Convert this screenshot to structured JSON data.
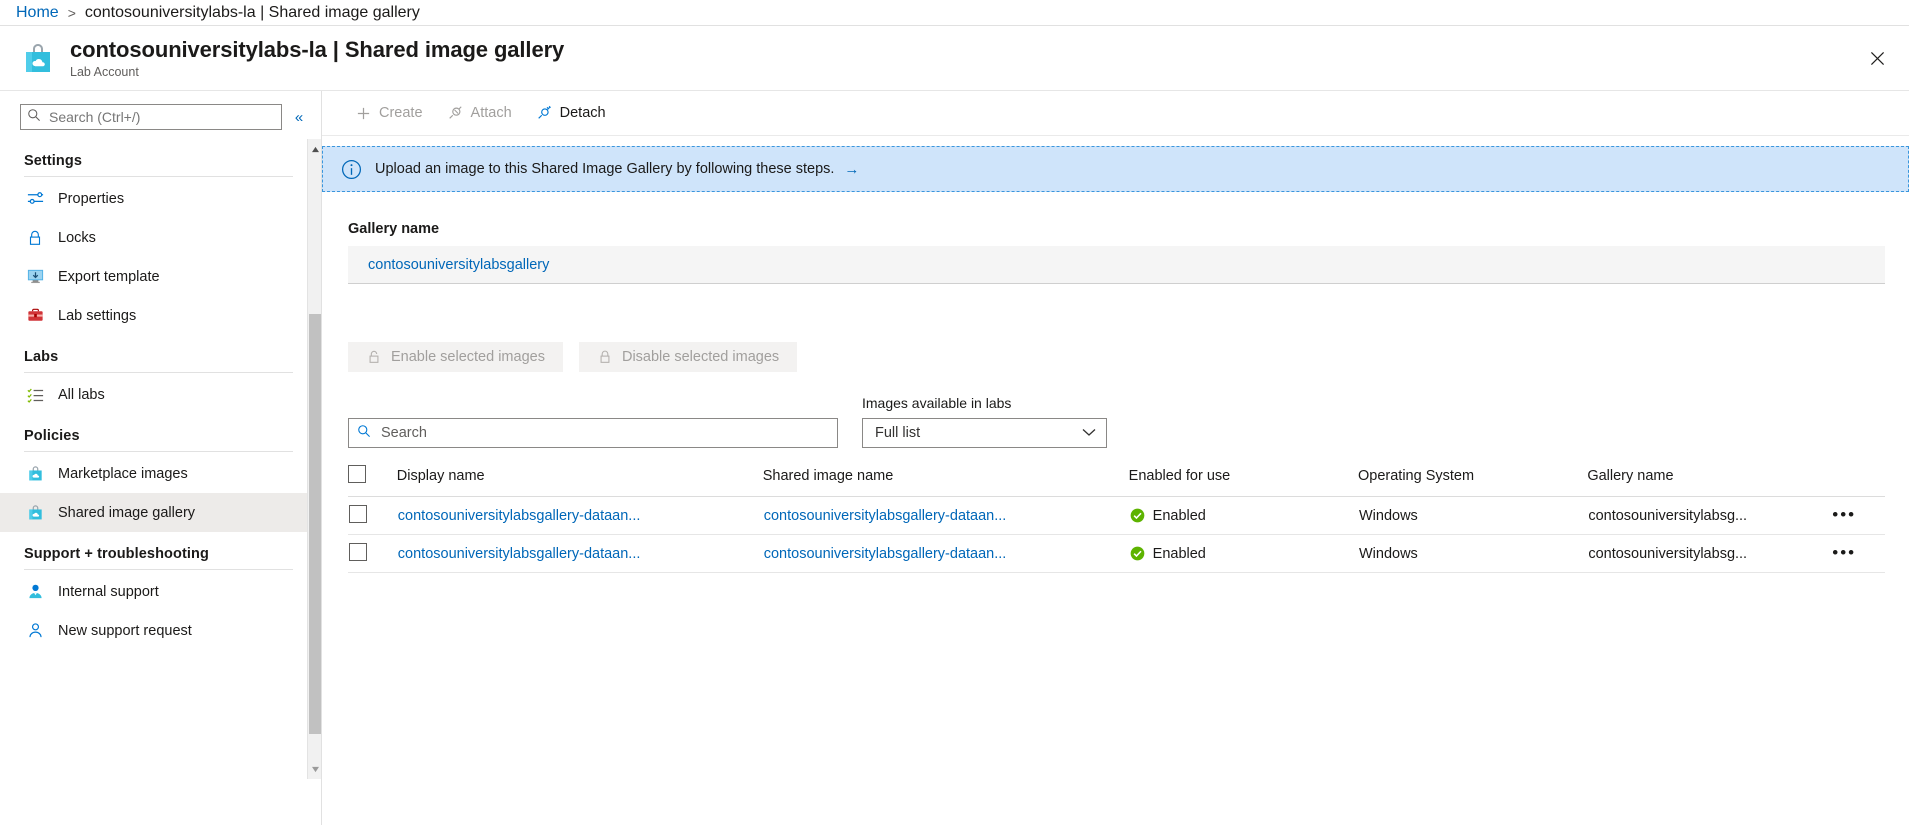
{
  "breadcrumb": {
    "home": "Home",
    "separator": ">",
    "current": "contosouniversitylabs-la | Shared image gallery"
  },
  "header": {
    "title": "contosouniversitylabs-la | Shared image gallery",
    "subtitle": "Lab Account",
    "icon": "lab-account-bag-icon",
    "close_label": "✕"
  },
  "sidebar": {
    "search_placeholder": "Search (Ctrl+/)",
    "search_value": "",
    "collapse_label": "«",
    "groups": [
      {
        "title": "Settings",
        "items": [
          {
            "label": "Properties",
            "icon": "properties-icon",
            "selected": false
          },
          {
            "label": "Locks",
            "icon": "lock-icon",
            "selected": false
          },
          {
            "label": "Export template",
            "icon": "export-template-icon",
            "selected": false
          },
          {
            "label": "Lab settings",
            "icon": "briefcase-icon",
            "selected": false
          }
        ]
      },
      {
        "title": "Labs",
        "items": [
          {
            "label": "All labs",
            "icon": "checklist-icon",
            "selected": false
          }
        ]
      },
      {
        "title": "Policies",
        "items": [
          {
            "label": "Marketplace images",
            "icon": "marketplace-bag-icon",
            "selected": false
          },
          {
            "label": "Shared image gallery",
            "icon": "shared-gallery-bag-icon",
            "selected": true
          }
        ]
      },
      {
        "title": "Support + troubleshooting",
        "items": [
          {
            "label": "Internal support",
            "icon": "support-person-icon",
            "selected": false
          },
          {
            "label": "New support request",
            "icon": "new-request-person-icon",
            "selected": false
          }
        ]
      }
    ]
  },
  "toolbar": {
    "buttons": [
      {
        "label": "Create",
        "icon": "plus-icon",
        "disabled": true
      },
      {
        "label": "Attach",
        "icon": "attach-plug-icon",
        "disabled": true
      },
      {
        "label": "Detach",
        "icon": "detach-plug-icon",
        "disabled": false
      }
    ]
  },
  "banner": {
    "icon": "info-icon",
    "text": "Upload an image to this Shared Image Gallery by following these steps.",
    "arrow": "→"
  },
  "gallery_section": {
    "label": "Gallery name",
    "value": "contosouniversitylabsgallery"
  },
  "image_actions": {
    "enable_label": "Enable selected images",
    "disable_label": "Disable selected images",
    "enable_disabled": true,
    "disable_disabled": true,
    "lock_icon": "lock-icon"
  },
  "filters": {
    "search_placeholder": "Search",
    "search_value": "",
    "dropdown_label": "Images available in labs",
    "dropdown_value": "Full list",
    "dropdown_chevron": "chevron-down-icon"
  },
  "table": {
    "columns": [
      "Display name",
      "Shared image name",
      "Enabled for use",
      "Operating System",
      "Gallery name"
    ],
    "select_all_checked": false,
    "rows": [
      {
        "checked": false,
        "display_name": "contosouniversitylabsgallery-dataan...",
        "shared_image_name": "contosouniversitylabsgallery-dataan...",
        "enabled": "Enabled",
        "enabled_icon": "check-circle-icon",
        "operating_system": "Windows",
        "gallery_name": "contosouniversitylabsg...",
        "more": "•••"
      },
      {
        "checked": false,
        "display_name": "contosouniversitylabsgallery-dataan...",
        "shared_image_name": "contosouniversitylabsgallery-dataan...",
        "enabled": "Enabled",
        "enabled_icon": "check-circle-icon",
        "operating_system": "Windows",
        "gallery_name": "contosouniversitylabsg...",
        "more": "•••"
      }
    ]
  },
  "colors": {
    "link": "#0067b8",
    "accent_cyan": "#32bedd",
    "banner_bg": "#cfe4fa",
    "banner_border": "#3a96dd",
    "enabled_green": "#5db300",
    "selected_nav": "#edebe9"
  }
}
